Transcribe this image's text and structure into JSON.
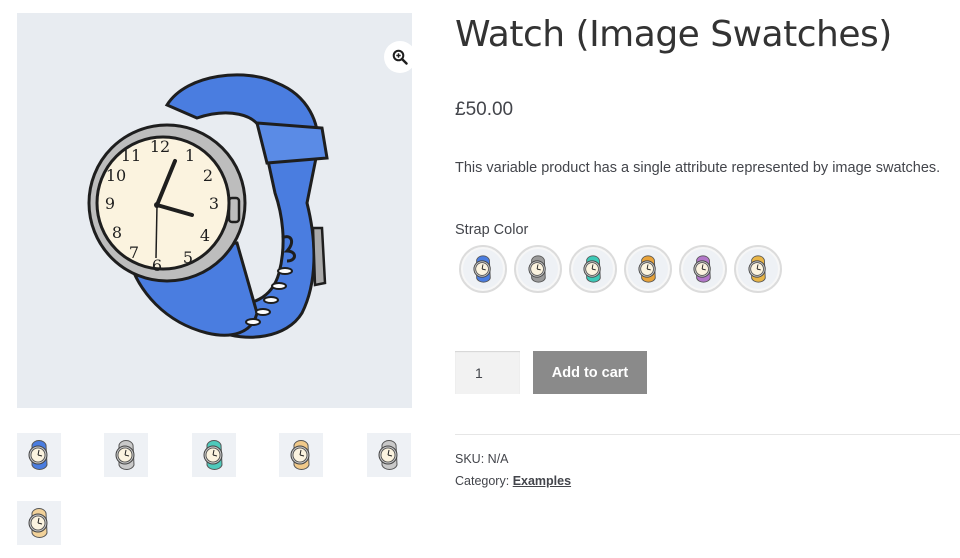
{
  "product": {
    "title": "Watch (Image Swatches)",
    "price": "£50.00",
    "description": "This variable product has a single attribute represented by image swatches.",
    "attribute_label": "Strap Color",
    "quantity": "1",
    "add_to_cart_label": "Add to cart",
    "sku_label": "SKU:",
    "sku_value": "N/A",
    "category_label": "Category:",
    "category_link": "Examples"
  },
  "swatches": [
    {
      "color": "#4a7de0"
    },
    {
      "color": "#9a9a9a"
    },
    {
      "color": "#3cc9b8"
    },
    {
      "color": "#e8a33a"
    },
    {
      "color": "#b277c9"
    },
    {
      "color": "#e8b547"
    }
  ],
  "thumbnails": [
    {
      "color": "#4a7de0"
    },
    {
      "color": "#c9c9c9"
    },
    {
      "color": "#4fc9bb"
    },
    {
      "color": "#f0c98a"
    },
    {
      "color": "#c9c9c9"
    },
    {
      "color": "#f2d29a"
    }
  ],
  "icons": {
    "zoom": "zoom-in-icon"
  },
  "colors": {
    "accent_button": "#8a8a8a",
    "gallery_bg": "#e8ecf1",
    "watch_strap": "#4a7de0",
    "watch_face": "#fbf3df"
  }
}
